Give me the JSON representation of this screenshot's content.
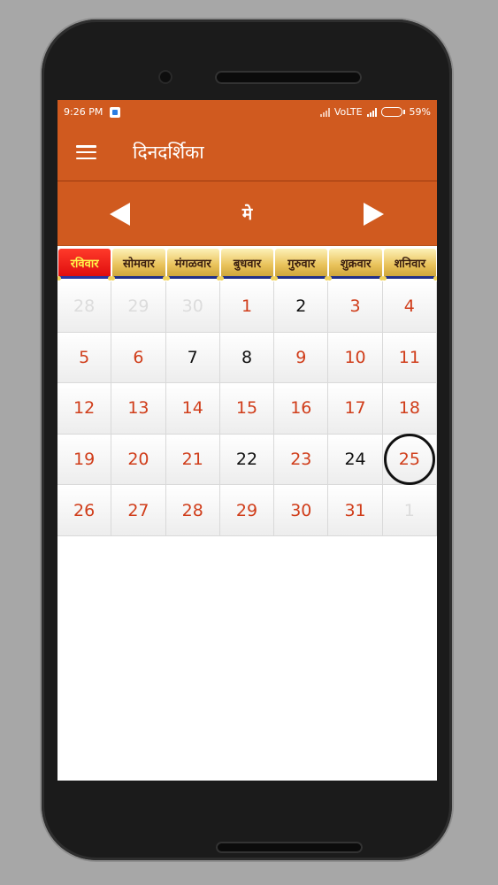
{
  "status_bar": {
    "time": "9:26 PM",
    "network_label": "VoLTE",
    "battery_percent": "59%"
  },
  "app_bar": {
    "menu_icon": "hamburger-icon",
    "title": "दिनदर्शिका"
  },
  "month_nav": {
    "prev_icon": "left-triangle-icon",
    "next_icon": "right-triangle-icon",
    "month_name": "मे"
  },
  "weekdays": [
    "रविवार",
    "सोमवार",
    "मंगळवार",
    "बुधवार",
    "गुरुवार",
    "शुक्रवार",
    "शनिवार"
  ],
  "calendar": {
    "days": [
      {
        "label": "28",
        "style": "faded"
      },
      {
        "label": "29",
        "style": "faded"
      },
      {
        "label": "30",
        "style": "faded"
      },
      {
        "label": "1",
        "style": "red"
      },
      {
        "label": "2",
        "style": "black"
      },
      {
        "label": "3",
        "style": "red"
      },
      {
        "label": "4",
        "style": "red"
      },
      {
        "label": "5",
        "style": "red"
      },
      {
        "label": "6",
        "style": "red"
      },
      {
        "label": "7",
        "style": "black"
      },
      {
        "label": "8",
        "style": "black"
      },
      {
        "label": "9",
        "style": "red"
      },
      {
        "label": "10",
        "style": "red"
      },
      {
        "label": "11",
        "style": "red"
      },
      {
        "label": "12",
        "style": "red"
      },
      {
        "label": "13",
        "style": "red"
      },
      {
        "label": "14",
        "style": "red"
      },
      {
        "label": "15",
        "style": "red"
      },
      {
        "label": "16",
        "style": "red"
      },
      {
        "label": "17",
        "style": "red"
      },
      {
        "label": "18",
        "style": "red"
      },
      {
        "label": "19",
        "style": "red"
      },
      {
        "label": "20",
        "style": "red"
      },
      {
        "label": "21",
        "style": "red"
      },
      {
        "label": "22",
        "style": "black"
      },
      {
        "label": "23",
        "style": "red"
      },
      {
        "label": "24",
        "style": "black"
      },
      {
        "label": "25",
        "style": "red",
        "today": true
      },
      {
        "label": "26",
        "style": "red"
      },
      {
        "label": "27",
        "style": "red"
      },
      {
        "label": "28",
        "style": "red"
      },
      {
        "label": "29",
        "style": "red"
      },
      {
        "label": "30",
        "style": "red"
      },
      {
        "label": "31",
        "style": "red"
      },
      {
        "label": "1",
        "style": "faded"
      }
    ]
  },
  "colors": {
    "primary": "#d05a1f",
    "holiday_red": "#d03d1a",
    "weekday_gold": "#e9c25a",
    "sunday_header": "#e00e0e"
  }
}
